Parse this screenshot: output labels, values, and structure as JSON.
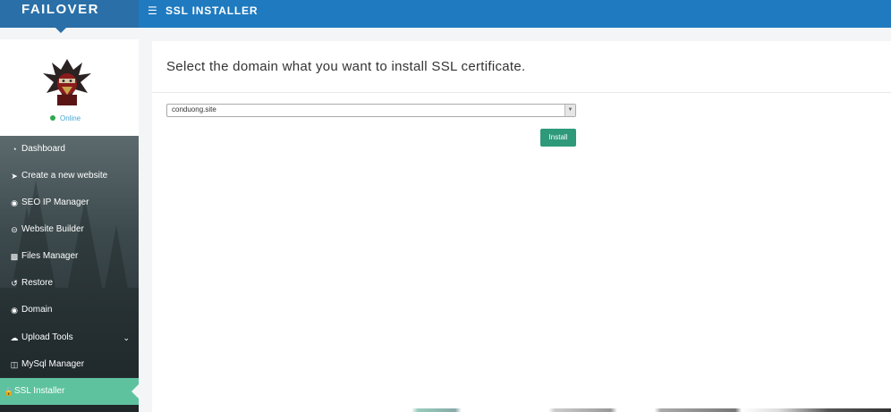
{
  "brand": {
    "name": "FAILOVER"
  },
  "header": {
    "title": "SSL INSTALLER",
    "menu_icon": "hamburger-icon"
  },
  "profile": {
    "status": "Online",
    "status_color": "#2fa84f"
  },
  "sidebar": {
    "items": [
      {
        "label": "Dashboard",
        "icon": "gauge-icon"
      },
      {
        "label": "Create a new website",
        "icon": "rocket-icon"
      },
      {
        "label": "SEO IP Manager",
        "icon": "globe-icon"
      },
      {
        "label": "Website Builder",
        "icon": "minus-circle-icon"
      },
      {
        "label": "Files Manager",
        "icon": "folder-icon"
      },
      {
        "label": "Restore",
        "icon": "history-icon"
      },
      {
        "label": "Domain",
        "icon": "globe-icon"
      },
      {
        "label": "Upload Tools",
        "icon": "cloud-upload-icon"
      },
      {
        "label": "MySql Manager",
        "icon": "database-icon"
      },
      {
        "label": "SSL Installer",
        "icon": "lock-icon"
      }
    ],
    "active_item": "SSL Installer",
    "accent": "#5ec29e"
  },
  "main": {
    "title": "Select the domain what you want to install SSL certificate.",
    "domain_select": {
      "value": "conduong.site"
    },
    "install_label": "Install",
    "button_color": "#2e9a7a"
  },
  "colors": {
    "topbar": "#1f7abf",
    "brand_bg": "#2a6fa8"
  }
}
